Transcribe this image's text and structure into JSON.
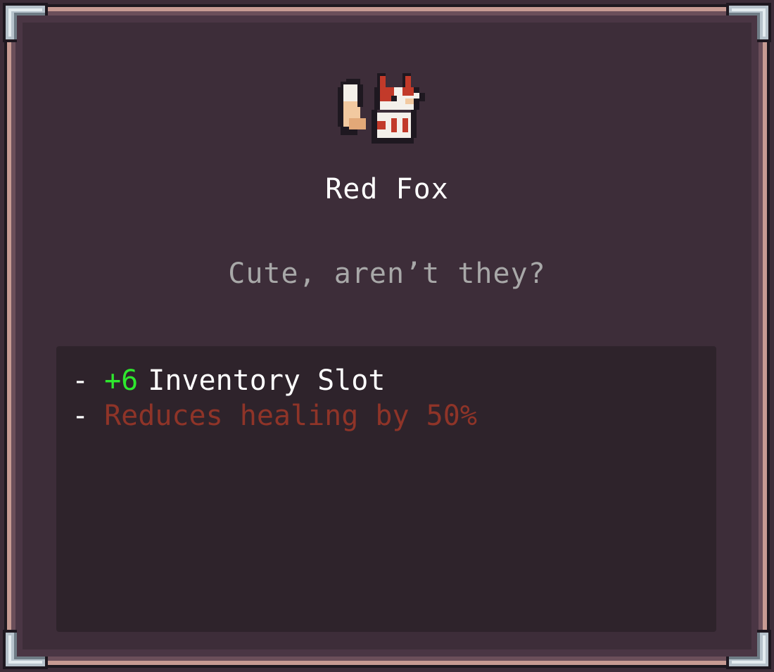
{
  "item": {
    "name": "Red Fox",
    "description": "Cute, aren’t they?",
    "icon": "red-fox-pixel-sprite"
  },
  "effects": [
    {
      "bullet": "-",
      "value": "+6",
      "text": "Inventory Slot",
      "type": "positive"
    },
    {
      "bullet": "-",
      "text": "Reduces healing by 50%",
      "type": "negative"
    }
  ],
  "colors": {
    "panel_bg": "#3d2d39",
    "effects_bg": "#2e232b",
    "title": "#ffffff",
    "description": "#a8a8a8",
    "positive_value": "#2ee82e",
    "negative_text": "#8f3428",
    "frame_rail": "#c79b93",
    "frame_corner": "#b7c3cc"
  }
}
